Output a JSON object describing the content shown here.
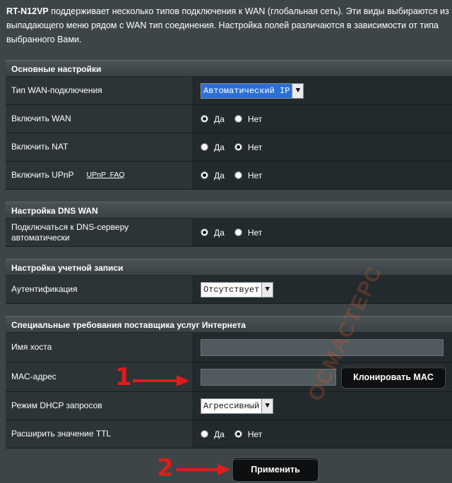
{
  "intro": {
    "model": "RT-N12VP",
    "line1_rest": " поддерживает несколько типов подключения к WAN (глобальная сеть). Эти виды выбираются из",
    "line2": "выпадающего меню рядом с WAN тип соединения. Настройка полей различаются в зависимости от типа",
    "line3": "выбранного Вами."
  },
  "basic": {
    "header": "Основные настройки",
    "wan_type_label": "Тип WAN-подключения",
    "wan_type_value": "Автоматический IP",
    "enable_wan_label": "Включить WAN",
    "enable_nat_label": "Включить NAT",
    "enable_upnp_label": "Включить UPnP",
    "upnp_faq": "UPnP  FAQ"
  },
  "dns": {
    "header": "Настройка DNS WAN",
    "auto_dns_label": "Подключаться к DNS-серверу автоматически"
  },
  "account": {
    "header": "Настройка учетной записи",
    "auth_label": "Аутентификация",
    "auth_value": "Отсутствует"
  },
  "isp": {
    "header": "Специальные требования поставщика услуг Интернета",
    "hostname_label": "Имя хоста",
    "hostname_value": "",
    "mac_label": "MAC-адрес",
    "mac_value": "",
    "clone_mac": "Клонировать MAC",
    "dhcp_label": "Режим DHCP запросов",
    "dhcp_value": "Агрессивный",
    "ttl_label": "Расширить значение TTL"
  },
  "radio": {
    "yes": "Да",
    "no": "Нет"
  },
  "radio_state": {
    "enable_wan": "yes",
    "enable_nat": "no",
    "enable_upnp": "yes",
    "auto_dns": "yes",
    "ttl": "no"
  },
  "annotations": {
    "step1": "1",
    "step2": "2"
  },
  "apply_button": "Применить",
  "watermark": "ОСМАСТЕРС",
  "colors": {
    "background": "#3e4548",
    "annotation": "#e21b1b",
    "selected": "#2b6fd6"
  }
}
